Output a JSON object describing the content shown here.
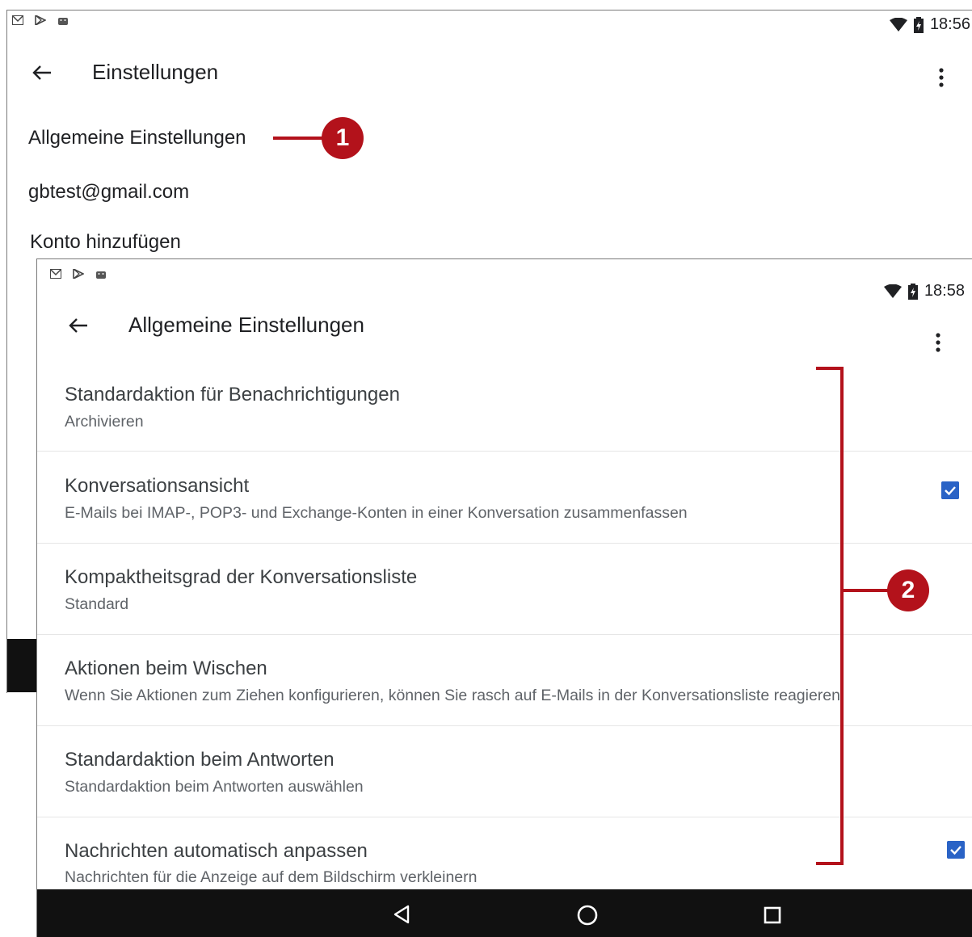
{
  "screen1": {
    "status_time": "18:56",
    "title": "Einstellungen",
    "items": [
      "Allgemeine Einstellungen",
      "gbtest@gmail.com",
      "Konto hinzufügen"
    ]
  },
  "screen2": {
    "status_time": "18:58",
    "title": "Allgemeine Einstellungen",
    "settings": [
      {
        "title": "Standardaktion für Benachrichtigungen",
        "subtitle": "Archivieren",
        "checked": null
      },
      {
        "title": "Konversationsansicht",
        "subtitle": "E-Mails bei IMAP-, POP3- und Exchange-Konten in einer Konversation zusammenfassen",
        "checked": true
      },
      {
        "title": "Kompaktheitsgrad der Konversationsliste",
        "subtitle": "Standard",
        "checked": null
      },
      {
        "title": "Aktionen beim Wischen",
        "subtitle": "Wenn Sie Aktionen zum Ziehen konfigurieren, können Sie rasch auf E-Mails in der Konversationsliste reagieren",
        "checked": null
      },
      {
        "title": "Standardaktion beim Antworten",
        "subtitle": "Standardaktion beim Antworten auswählen",
        "checked": null
      },
      {
        "title": "Nachrichten automatisch anpassen",
        "subtitle": "Nachrichten für die Anzeige auf dem Bildschirm verkleinern",
        "checked": true
      }
    ]
  },
  "callouts": {
    "one": "1",
    "two": "2"
  },
  "colors": {
    "accent": "#b3121b",
    "checkbox": "#2a63c6"
  },
  "icons": [
    "gmail-icon",
    "play-store-icon",
    "android-icon",
    "wifi-icon",
    "battery-icon",
    "back-arrow-icon",
    "overflow-menu-icon",
    "checkbox-checked-icon",
    "nav-back-icon",
    "nav-home-icon",
    "nav-recents-icon"
  ]
}
